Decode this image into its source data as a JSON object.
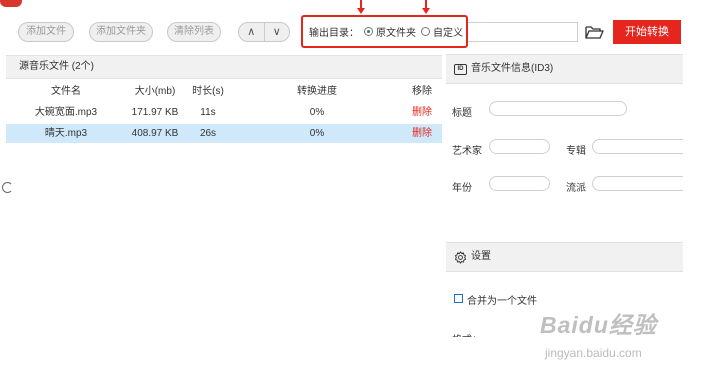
{
  "toolbar": {
    "add_file": "添加文件",
    "add_folder": "添加文件夹",
    "clear_list": "清除列表",
    "move_up": "∧",
    "move_down": "∨",
    "output_dir_label": "输出目录：",
    "output_option_original": "原文件夹",
    "output_option_custom": "自定义",
    "output_selected": "原文件夹",
    "start_button": "开始转换",
    "accent_color": "#e5261f"
  },
  "file_list": {
    "header": "源音乐文件 (2个)",
    "columns": [
      "文件名",
      "大小(mb)",
      "时长(s)",
      "转换进度",
      "移除"
    ],
    "rows": [
      {
        "name": "大碗宽面.mp3",
        "size": "171.97 KB",
        "duration": "11s",
        "progress": "0%",
        "remove": "删除",
        "selected": false
      },
      {
        "name": "晴天.mp3",
        "size": "408.97 KB",
        "duration": "26s",
        "progress": "0%",
        "remove": "删除",
        "selected": true
      }
    ]
  },
  "id3_panel": {
    "icon": "id3-icon",
    "title": "音乐文件信息(ID3)",
    "title_label": "标题",
    "artist_label": "艺术家",
    "album_label": "专辑",
    "year_label": "年份",
    "genre_label": "流派"
  },
  "settings_panel": {
    "icon": "gear-icon",
    "title": "设置",
    "merge_label": "合并为一个文件",
    "merge_checked": false,
    "partial_label": "格式："
  },
  "watermark": {
    "brand": "Baidu经验",
    "url": "jingyan.baidu.com"
  }
}
